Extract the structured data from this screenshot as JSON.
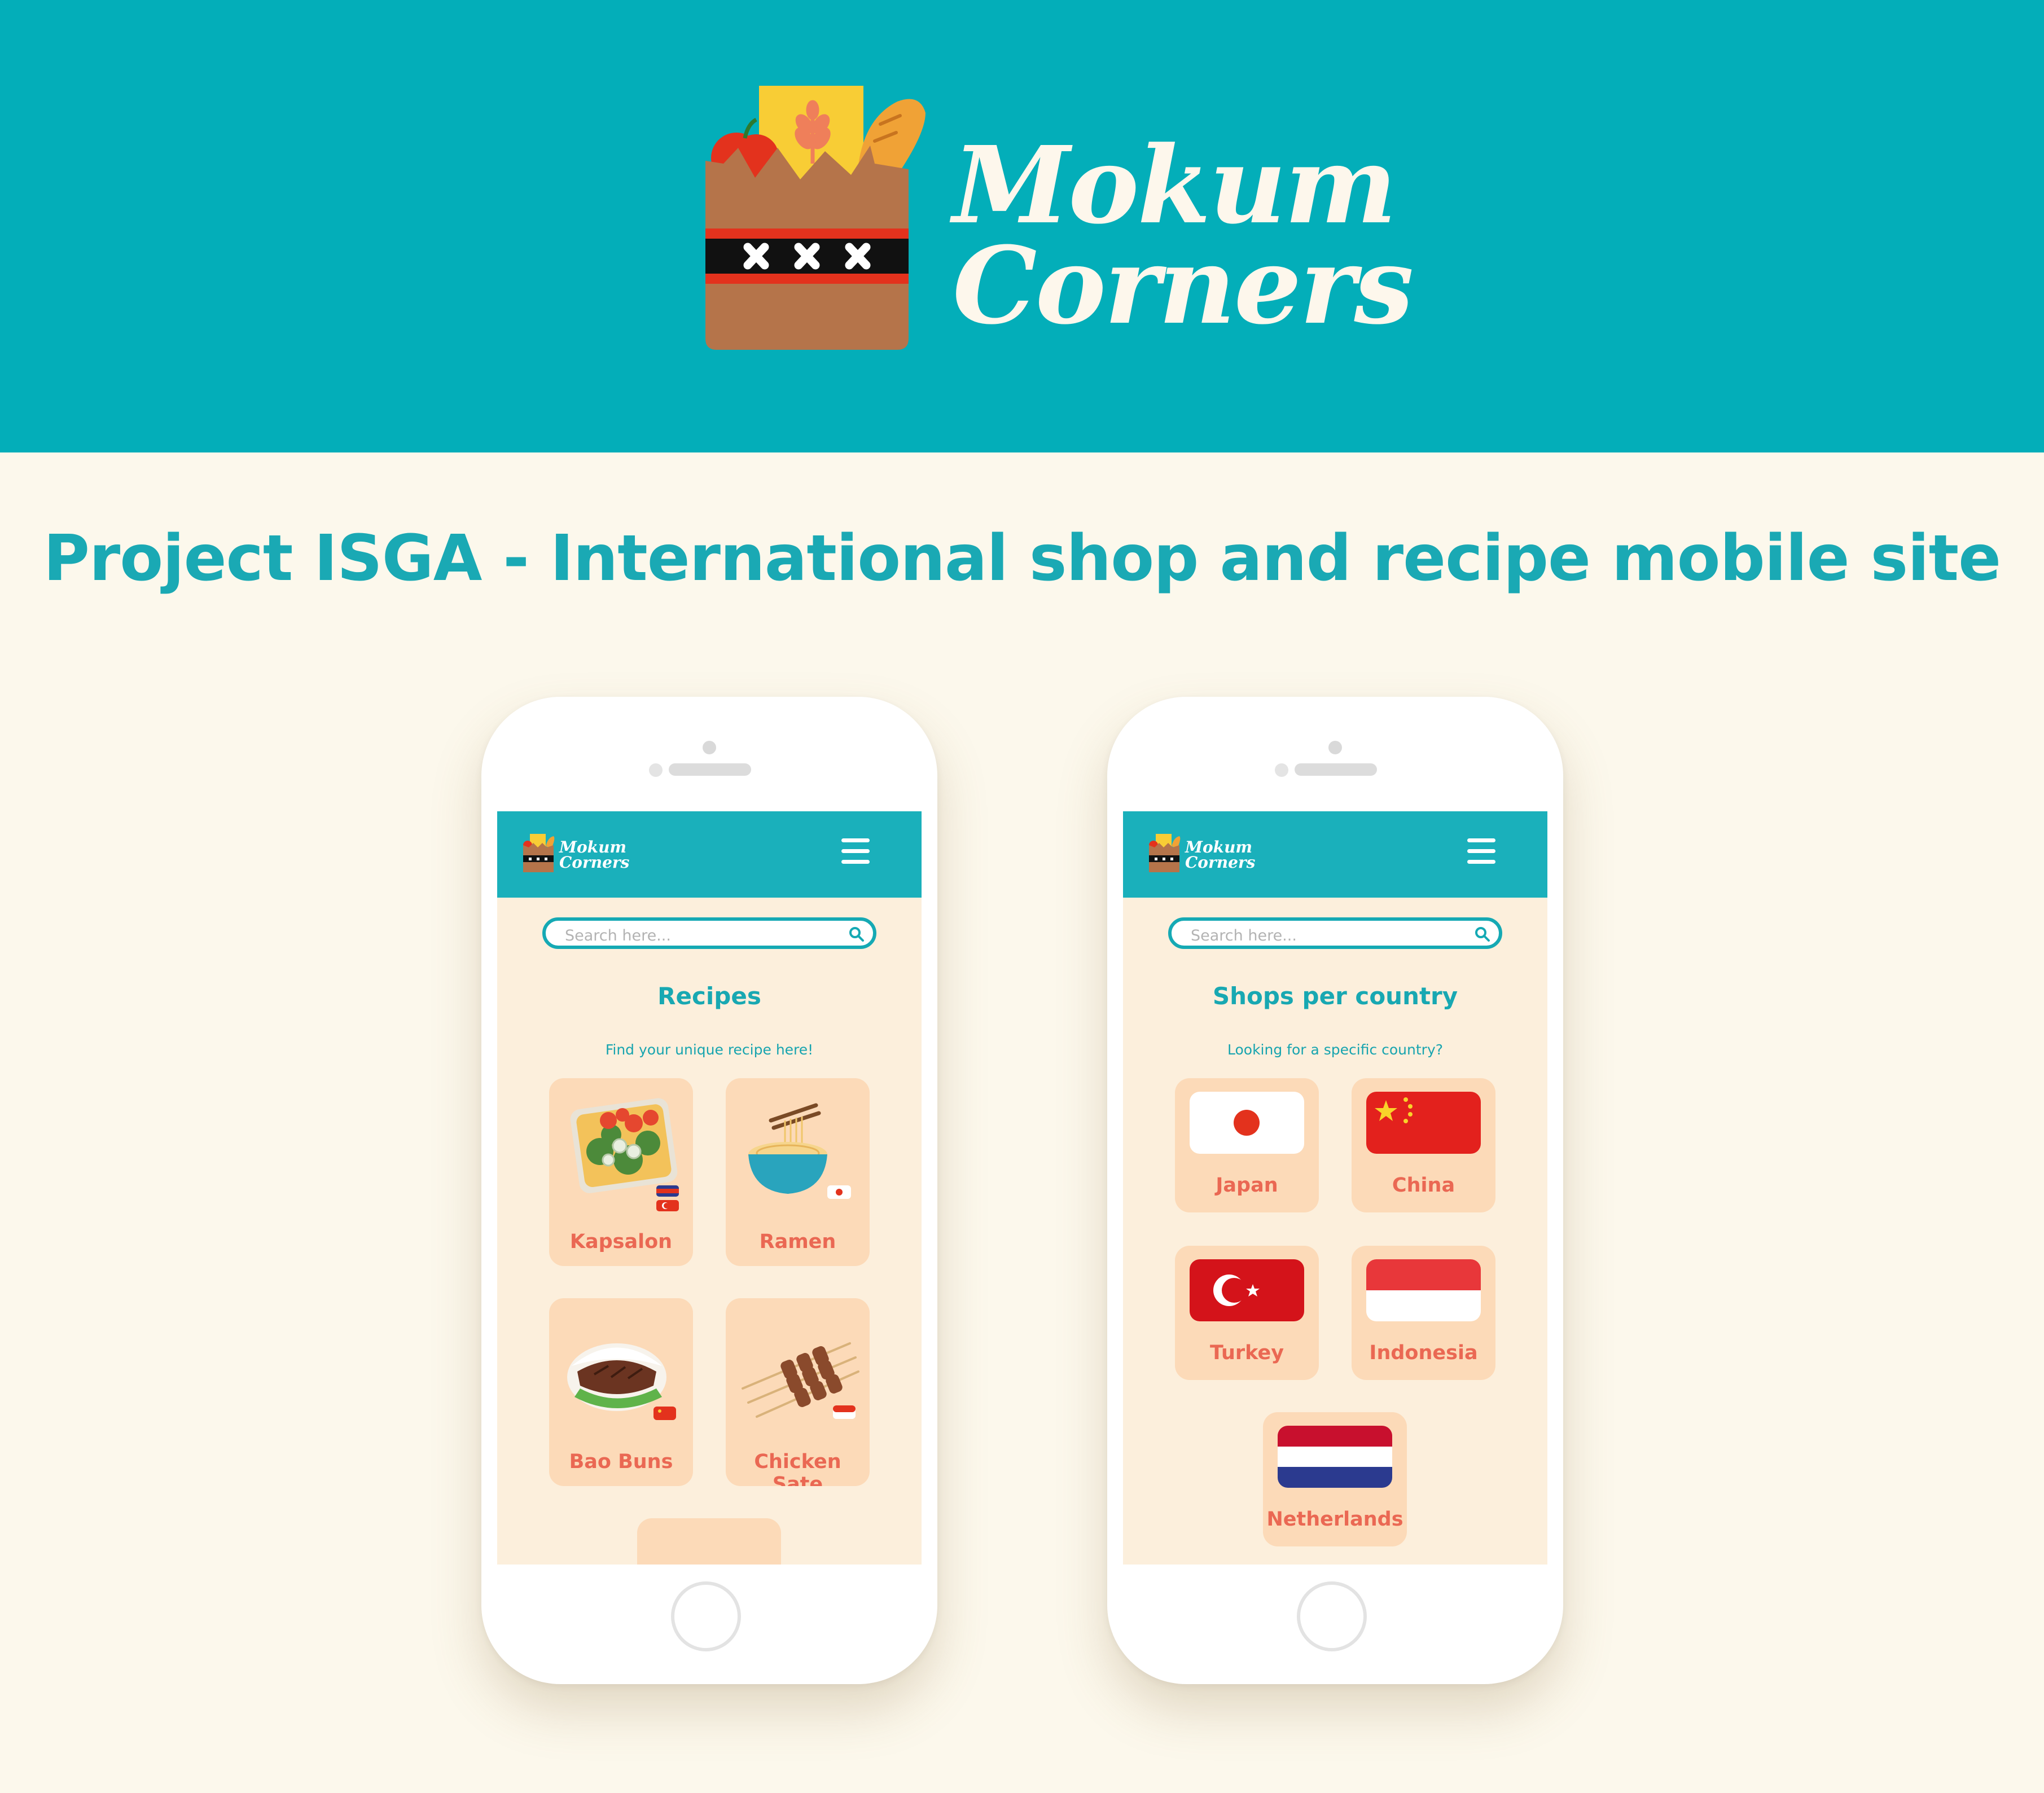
{
  "colors": {
    "teal": "#03aeb9",
    "cream": "#fcf8ec",
    "card": "#fcdab8",
    "label": "#ea6853"
  },
  "brand": {
    "line1": "Mokum",
    "line2": "Corners"
  },
  "headline": "Project ISGA - International shop and recipe mobile site",
  "search": {
    "placeholder": "Search here..."
  },
  "recipes_screen": {
    "title": "Recipes",
    "subtitle": "Find your unique recipe here!",
    "cards": [
      {
        "label": "Kapsalon",
        "icon": "kapsalon-dish-icon"
      },
      {
        "label": "Ramen",
        "icon": "ramen-bowl-icon"
      },
      {
        "label": "Bao Buns",
        "icon": "bao-bun-icon"
      },
      {
        "label": "Chicken Sate",
        "icon": "chicken-skewers-icon"
      }
    ]
  },
  "shops_screen": {
    "title": "Shops per country",
    "subtitle": "Looking for a specific country?",
    "countries": [
      {
        "label": "Japan",
        "icon": "japan-flag-icon"
      },
      {
        "label": "China",
        "icon": "china-flag-icon"
      },
      {
        "label": "Turkey",
        "icon": "turkey-flag-icon"
      },
      {
        "label": "Indonesia",
        "icon": "indonesia-flag-icon"
      },
      {
        "label": "Netherlands",
        "icon": "netherlands-flag-icon"
      }
    ]
  }
}
